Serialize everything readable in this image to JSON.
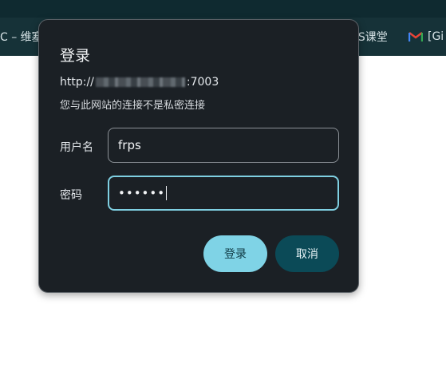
{
  "browser": {
    "bookmarks": {
      "left_partial": "C – 维塞",
      "right_item_1": "SS课堂",
      "right_item_2": "[Gi"
    }
  },
  "dialog": {
    "title": "登录",
    "url_prefix": "http://",
    "url_suffix": ":7003",
    "warning": "您与此网站的连接不是私密连接",
    "username_label": "用户名",
    "username_value": "frps",
    "password_label": "密码",
    "password_mask": "••••••",
    "login_button": "登录",
    "cancel_button": "取消"
  },
  "colors": {
    "dialog_bg": "#1b2025",
    "focus_border": "#7fd0e2",
    "primary_button": "#7fd3e6",
    "secondary_button": "#0b4a57"
  },
  "icons": {
    "bookmark_gmail": "gmail-icon"
  }
}
